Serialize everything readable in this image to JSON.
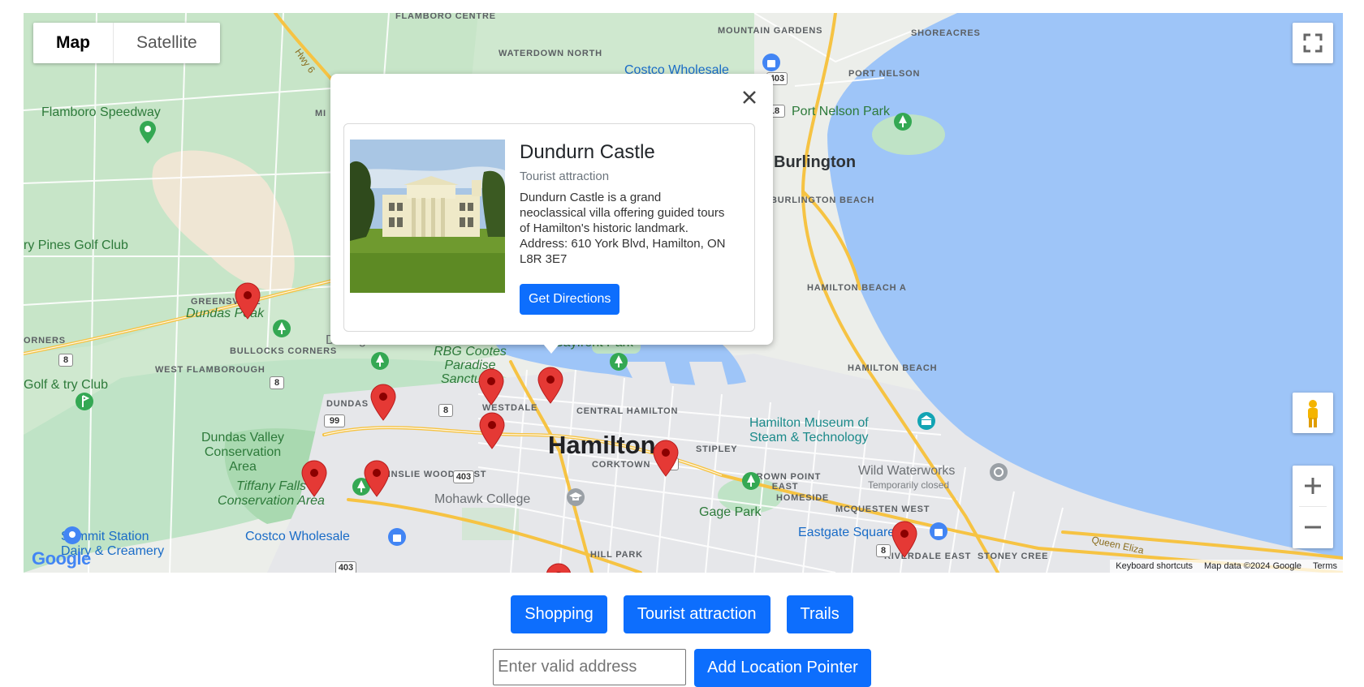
{
  "map": {
    "type_control": {
      "map_label": "Map",
      "satellite_label": "Satellite"
    },
    "attribution": {
      "keyboard": "Keyboard shortcuts",
      "data": "Map data ©2024 Google",
      "terms": "Terms"
    },
    "logo": "Google",
    "labels": {
      "flamboro_centre": "FLAMBORO CENTRE",
      "waterdown_north": "WATERDOWN NORTH",
      "mountain_gardens": "MOUNTAIN GARDENS",
      "shoreacres": "SHOREACRES",
      "port_nelson": "PORT NELSON",
      "port_nelson_park": "Port Nelson Park",
      "costco_north": "Costco Wholesale",
      "flamboro_speedway": "Flamboro Speedway",
      "burlington": "Burlington",
      "burlington_beach": "BURLINGTON BEACH",
      "pines_golf": "ry Pines Golf Club",
      "greensville": "GREENSVILLE",
      "dundas_peak": "Dundas Peak",
      "corners": "ORNERS",
      "bullocks_corners": "BULLOCKS CORNERS",
      "west_flamborough": "WEST FLAMBOROUGH",
      "golf_club": "Golf & try Club",
      "driving_park": "Driving Park",
      "rbg": "RBG Cootes Paradise Sanctuary",
      "bayfront_park": "Bayfront Park",
      "hamilton_beach_a": "HAMILTON BEACH A",
      "hamilton_beach": "HAMILTON BEACH",
      "dundas": "DUNDAS",
      "westdale": "WESTDALE",
      "central_hamilton": "CENTRAL HAMILTON",
      "hamilton": "Hamilton",
      "museum": "Hamilton Museum of Steam & Technology",
      "dundas_valley": "Dundas Valley Conservation Area",
      "ainslie_wood_west": "AINSLIE WOOD WEST",
      "corktown": "CORKTOWN",
      "stipley": "STIPLEY",
      "crown_point_east": "CROWN POINT EAST",
      "homeside": "HOMESIDE",
      "wild_waterworks": "Wild Waterworks",
      "temporarily_closed": "Temporarily closed",
      "tiffany_falls": "Tiffany Falls Conservation Area",
      "mohawk_college": "Mohawk College",
      "gage_park": "Gage Park",
      "mcquesten_west": "MCQUESTEN WEST",
      "eastgate_square": "Eastgate Square",
      "summit_station": "Summit Station Dairy & Creamery",
      "costco_south": "Costco Wholesale",
      "hill_park": "HILL PARK",
      "riverdale_east": "RIVERDALE EAST",
      "stoney_creek": "STONEY CREE",
      "queen_elizabeth": "Queen Eliza",
      "hwy6": "Hwy 6",
      "mi": "MI",
      "stoney": "STONEY"
    },
    "shields": {
      "s403": "403",
      "s18": "18",
      "s8a": "8",
      "s8b": "8",
      "s8c": "8",
      "s99": "99",
      "s403b": "403",
      "s8d": "8",
      "s8e": "8",
      "s403c": "403"
    }
  },
  "info_window": {
    "title": "Dundurn Castle",
    "type": "Tourist attraction",
    "description": "Dundurn Castle is a grand neoclassical villa offering guided tours of Hamilton's historic landmark. Address: 610 York Blvd, Hamilton, ON L8R 3E7",
    "button": "Get Directions"
  },
  "filters": [
    "Shopping",
    "Tourist attraction",
    "Trails"
  ],
  "add_location": {
    "placeholder": "Enter valid address",
    "value": "",
    "button": "Add Location Pointer"
  },
  "colors": {
    "water": "#9ec5f8",
    "park": "#bfe3c6",
    "road_major": "#f6c343",
    "land": "#eceeea",
    "marker": "#e53935",
    "button": "#0d6efd"
  }
}
